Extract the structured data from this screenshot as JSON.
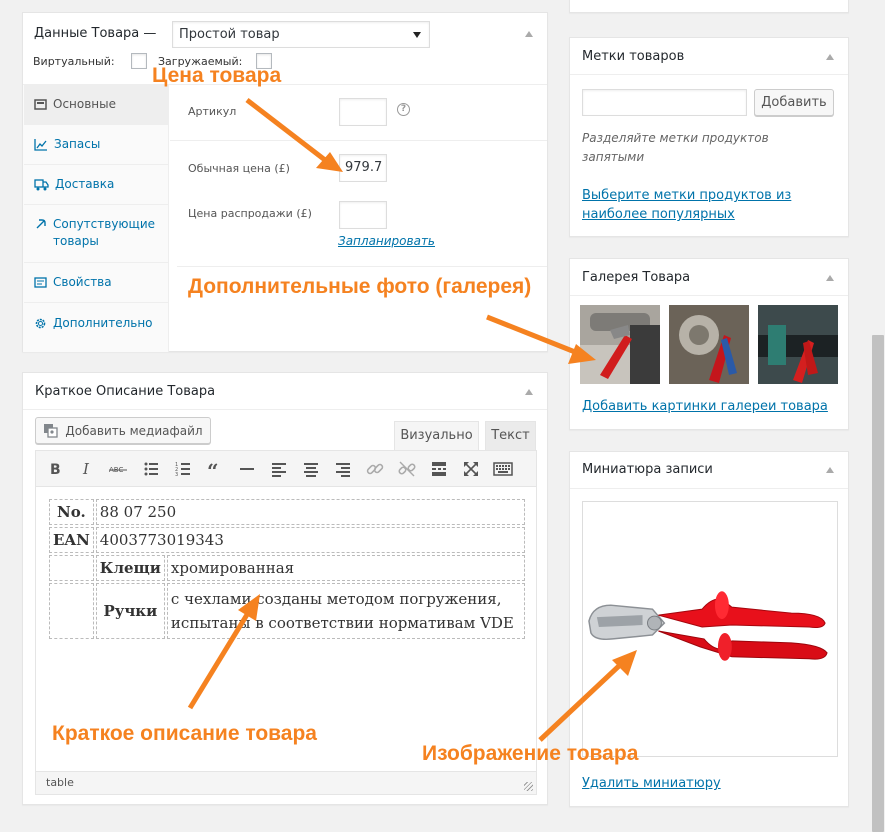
{
  "product_data": {
    "title": "Данные Товара —",
    "type_select": "Простой товар",
    "virtual_label": "Виртуальный:",
    "downloadable_label": "Загружаемый:",
    "tabs": [
      {
        "label": "Основные",
        "icon": "settings-icon"
      },
      {
        "label": "Запасы",
        "icon": "inventory-icon"
      },
      {
        "label": "Доставка",
        "icon": "truck-icon"
      },
      {
        "label": "Сопутствующие товары",
        "icon": "link-icon"
      },
      {
        "label": "Свойства",
        "icon": "list-icon"
      },
      {
        "label": "Дополнительно",
        "icon": "gear-icon"
      }
    ],
    "sku_label": "Артикул",
    "sku_value": "",
    "regular_price_label": "Обычная цена (£)",
    "regular_price_value": "979.7",
    "sale_price_label": "Цена распродажи (£)",
    "sale_price_value": "",
    "schedule_link": "Запланировать"
  },
  "short_description": {
    "title": "Краткое Описание Товара",
    "add_media": "Добавить медиафайл",
    "tab_visual": "Визуально",
    "tab_text": "Текст",
    "toolbar": [
      "bold-icon",
      "italic-icon",
      "strikethrough-icon",
      "bullet-list-icon",
      "numbered-list-icon",
      "blockquote-icon",
      "horizontal-rule-icon",
      "align-left-icon",
      "align-center-icon",
      "align-right-icon",
      "insert-link-icon",
      "remove-link-icon",
      "read-more-icon",
      "fullscreen-icon",
      "kitchen-sink-icon"
    ],
    "table": {
      "no_label": "No.",
      "no_value": "88 07 250",
      "ean_label": "EAN",
      "ean_value": "4003773019343",
      "pliers_label": "Клещи",
      "pliers_value": "хромированная",
      "handles_label": "Ручки",
      "handles_value_1": "с чехлами созданы методом погружения,",
      "handles_value_2": "испытаны в соответствии нормативам VDE"
    },
    "status_path": "table"
  },
  "tags": {
    "title": "Метки товаров",
    "input_placeholder": "",
    "add_button": "Добавить",
    "hint_1": "Разделяйте метки продуктов",
    "hint_2": "запятыми",
    "popular_link_1": "Выберите метки продуктов из",
    "popular_link_2": "наиболее популярных"
  },
  "gallery": {
    "title": "Галерея Товара",
    "add_link": "Добавить картинки галереи товара"
  },
  "thumbnail": {
    "title": "Миниатюра записи",
    "remove_link": "Удалить миниатюру"
  },
  "annotations": {
    "price": "Цена товара",
    "gallery": "Дополнительные фото (галерея)",
    "short_desc": "Краткое описание товара",
    "image": "Изображение товара"
  },
  "colors": {
    "accent": "#f58220",
    "link": "#0073aa"
  }
}
